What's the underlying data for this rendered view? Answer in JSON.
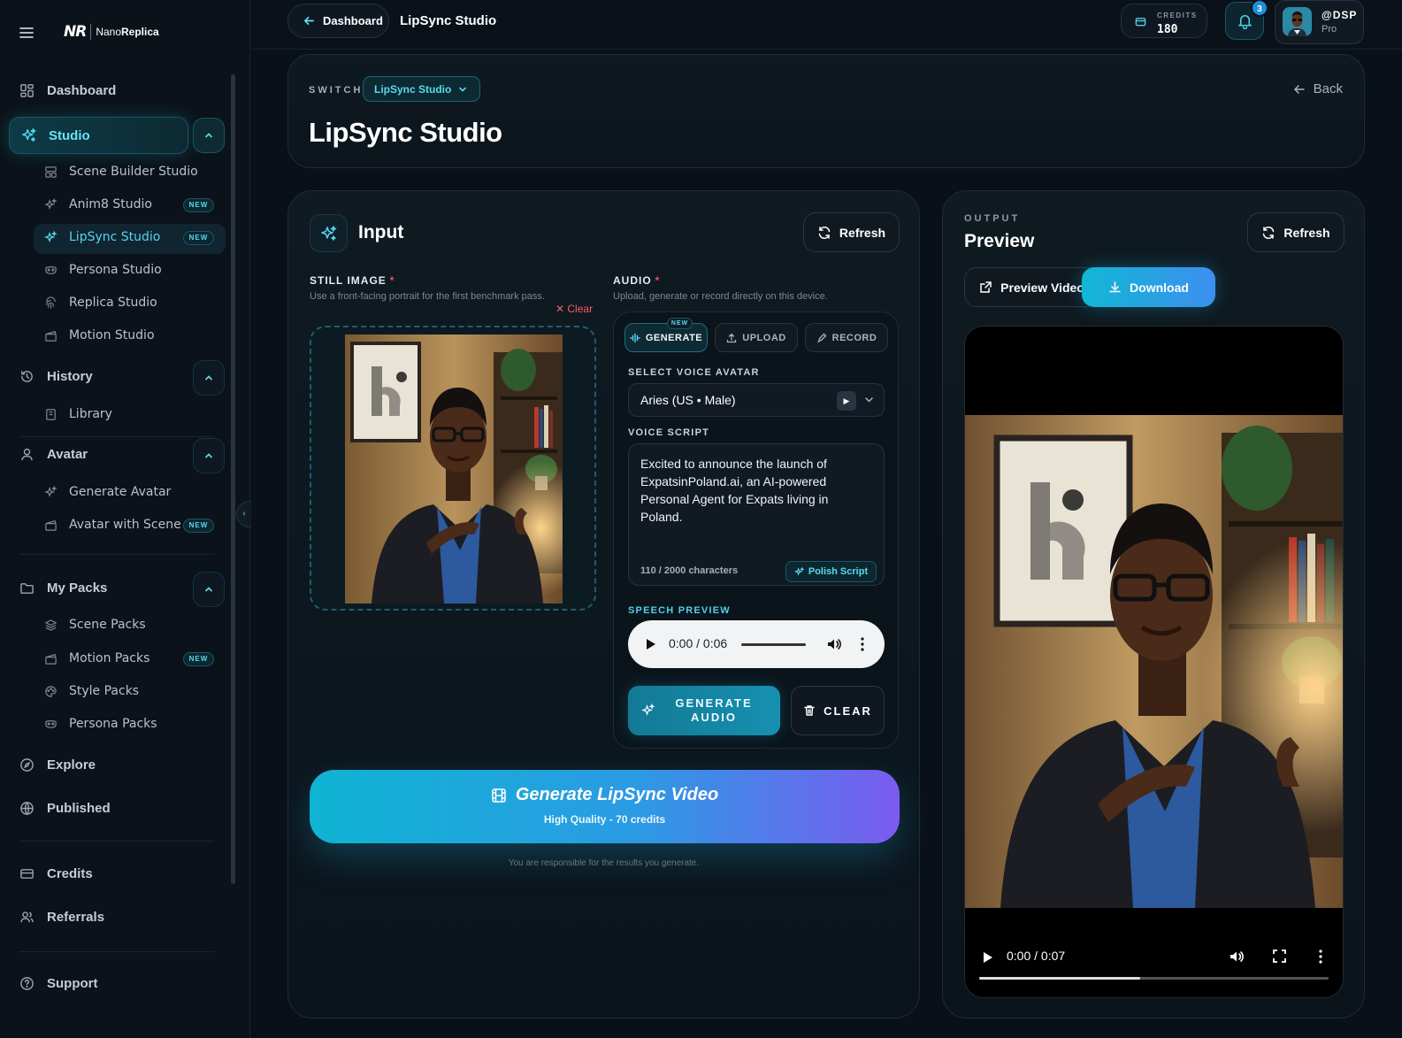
{
  "app": {
    "brand_mark": "NR",
    "brand_name_light": "Nano",
    "brand_name_bold": "Replica"
  },
  "sidebar": {
    "dashboard": "Dashboard",
    "studio": "Studio",
    "studio_items": [
      {
        "label": "Scene Builder Studio",
        "badge": ""
      },
      {
        "label": "Anim8 Studio",
        "badge": "NEW"
      },
      {
        "label": "LipSync Studio",
        "badge": "NEW"
      },
      {
        "label": "Persona Studio",
        "badge": ""
      },
      {
        "label": "Replica Studio",
        "badge": ""
      },
      {
        "label": "Motion Studio",
        "badge": ""
      }
    ],
    "history": "History",
    "history_items": [
      {
        "label": "Library"
      }
    ],
    "avatar": "Avatar",
    "avatar_items": [
      {
        "label": "Generate Avatar",
        "badge": ""
      },
      {
        "label": "Avatar with Scene",
        "badge": "NEW"
      }
    ],
    "my_packs": "My Packs",
    "pack_items": [
      {
        "label": "Scene Packs",
        "badge": ""
      },
      {
        "label": "Motion Packs",
        "badge": "NEW"
      },
      {
        "label": "Style Packs",
        "badge": ""
      },
      {
        "label": "Persona Packs",
        "badge": ""
      }
    ],
    "explore": "Explore",
    "published": "Published",
    "credits": "Credits",
    "referrals": "Referrals",
    "support": "Support"
  },
  "topbar": {
    "back_label": "Dashboard",
    "title": "LipSync Studio",
    "credits_label": "CREDITS",
    "credits_value": "180",
    "notification_count": "3",
    "user_handle": "@DSP",
    "user_plan": "Pro"
  },
  "header": {
    "switch_label": "SWITCH",
    "switch_value": "LipSync Studio",
    "title": "LipSync Studio",
    "back_label": "Back"
  },
  "input": {
    "title": "Input",
    "refresh_label": "Refresh",
    "still_image_label": "STILL IMAGE",
    "required_mark": "*",
    "still_image_help": "Use a front-facing portrait for the first benchmark pass.",
    "clear_label": "Clear",
    "audio_label": "AUDIO",
    "audio_help": "Upload, generate or record directly on this device.",
    "tabs": [
      {
        "label": "GENERATE",
        "badge": "NEW",
        "icon": "waveform-icon"
      },
      {
        "label": "UPLOAD",
        "icon": "upload-icon"
      },
      {
        "label": "RECORD",
        "icon": "mic-icon"
      }
    ],
    "voice_avatar_label": "SELECT VOICE AVATAR",
    "voice_avatar_value": "Aries (US • Male)",
    "voice_script_label": "VOICE SCRIPT",
    "voice_script_text": "Excited to announce the launch of ExpatsinPoland.ai, an AI-powered Personal Agent for Expats living in Poland.",
    "char_count": "110 / 2000 characters",
    "polish_label": "Polish Script",
    "speech_preview_label": "SPEECH PREVIEW",
    "speech_time": "0:00 / 0:06",
    "generate_audio_label": "GENERATE AUDIO",
    "clear_audio_label": "CLEAR",
    "generate_video_label": "Generate LipSync Video",
    "generate_video_sub": "High Quality - 70 credits",
    "disclaimer": "You are responsible for the results you generate."
  },
  "output": {
    "section_label": "OUTPUT",
    "title": "Preview",
    "refresh_label": "Refresh",
    "preview_video_label": "Preview Video",
    "download_label": "Download",
    "video_time": "0:00 / 0:07",
    "video_buffered_fraction": 0.46
  },
  "colors": {
    "accent": "#55d5ec",
    "danger": "#ff4a63",
    "gradient_end": "#7b5bf0"
  }
}
